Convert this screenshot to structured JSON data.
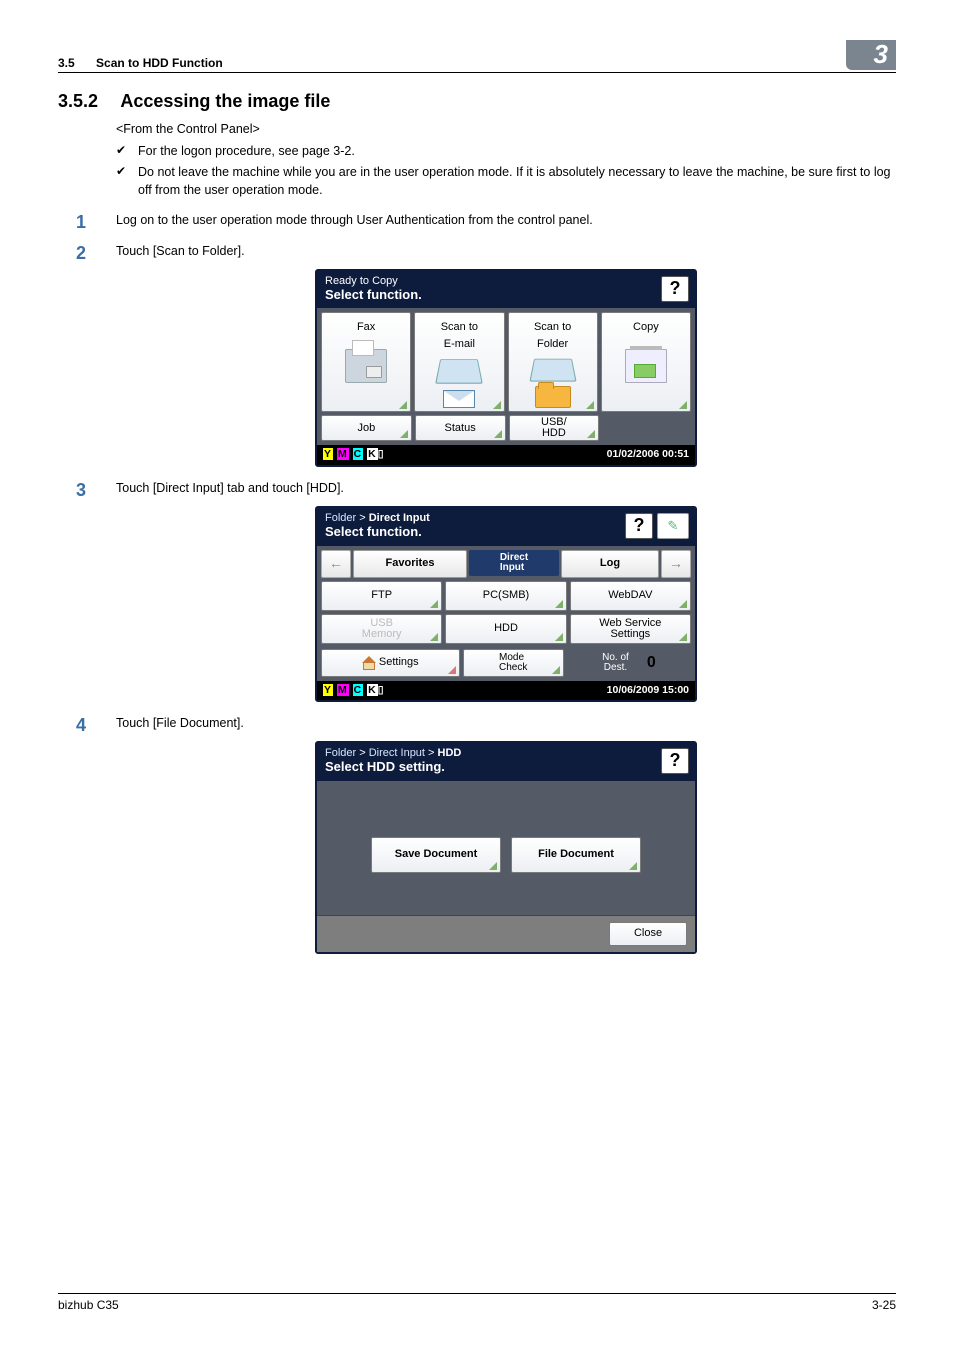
{
  "header": {
    "section": "3.5",
    "title": "Scan to HDD Function",
    "chapter": "3"
  },
  "h2": {
    "num": "3.5.2",
    "text": "Accessing the image file"
  },
  "subtitle": "<From the Control Panel>",
  "bullets": [
    "For the logon procedure, see page 3-2.",
    "Do not leave the machine while you are in the user operation mode. If it is absolutely necessary to leave the machine, be sure first to log off from the user operation mode."
  ],
  "steps": [
    "Log on to the user operation mode through User Authentication from the control panel.",
    "Touch [Scan to Folder].",
    "Touch [Direct Input] tab and touch [HDD].",
    "Touch [File Document]."
  ],
  "panel1": {
    "ln1": "Ready to Copy",
    "ln2": "Select function.",
    "help": "?",
    "fax": "Fax",
    "email": "Scan to\nE-mail",
    "folder": "Scan to\nFolder",
    "copy": "Copy",
    "job": "Job",
    "status": "Status",
    "usb": "USB/\nHDD",
    "ymck": "Y M C K",
    "time": "01/02/2006  00:51"
  },
  "panel2": {
    "crumb1": "Folder",
    "crumb2": "Direct Input",
    "ln2": "Select function.",
    "help": "?",
    "tab_fav": "Favorites",
    "tab_direct": "Direct\nInput",
    "tab_log": "Log",
    "ftp": "FTP",
    "pcsmb": "PC(SMB)",
    "webdav": "WebDAV",
    "usbmem": "USB\nMemory",
    "hdd": "HDD",
    "webserv": "Web Service\nSettings",
    "settings": "Settings",
    "modecheck": "Mode\nCheck",
    "dest_lbl": "No. of\nDest.",
    "dest_val": "0",
    "ymck": "Y M C K",
    "time": "10/06/2009  15:00"
  },
  "panel3": {
    "crumb1": "Folder",
    "crumb2": "Direct Input",
    "crumb3": "HDD",
    "ln2": "Select HDD setting.",
    "help": "?",
    "savedoc": "Save Document",
    "filedoc": "File Document",
    "close": "Close"
  },
  "footer": {
    "left": "bizhub C35",
    "right": "3-25"
  }
}
